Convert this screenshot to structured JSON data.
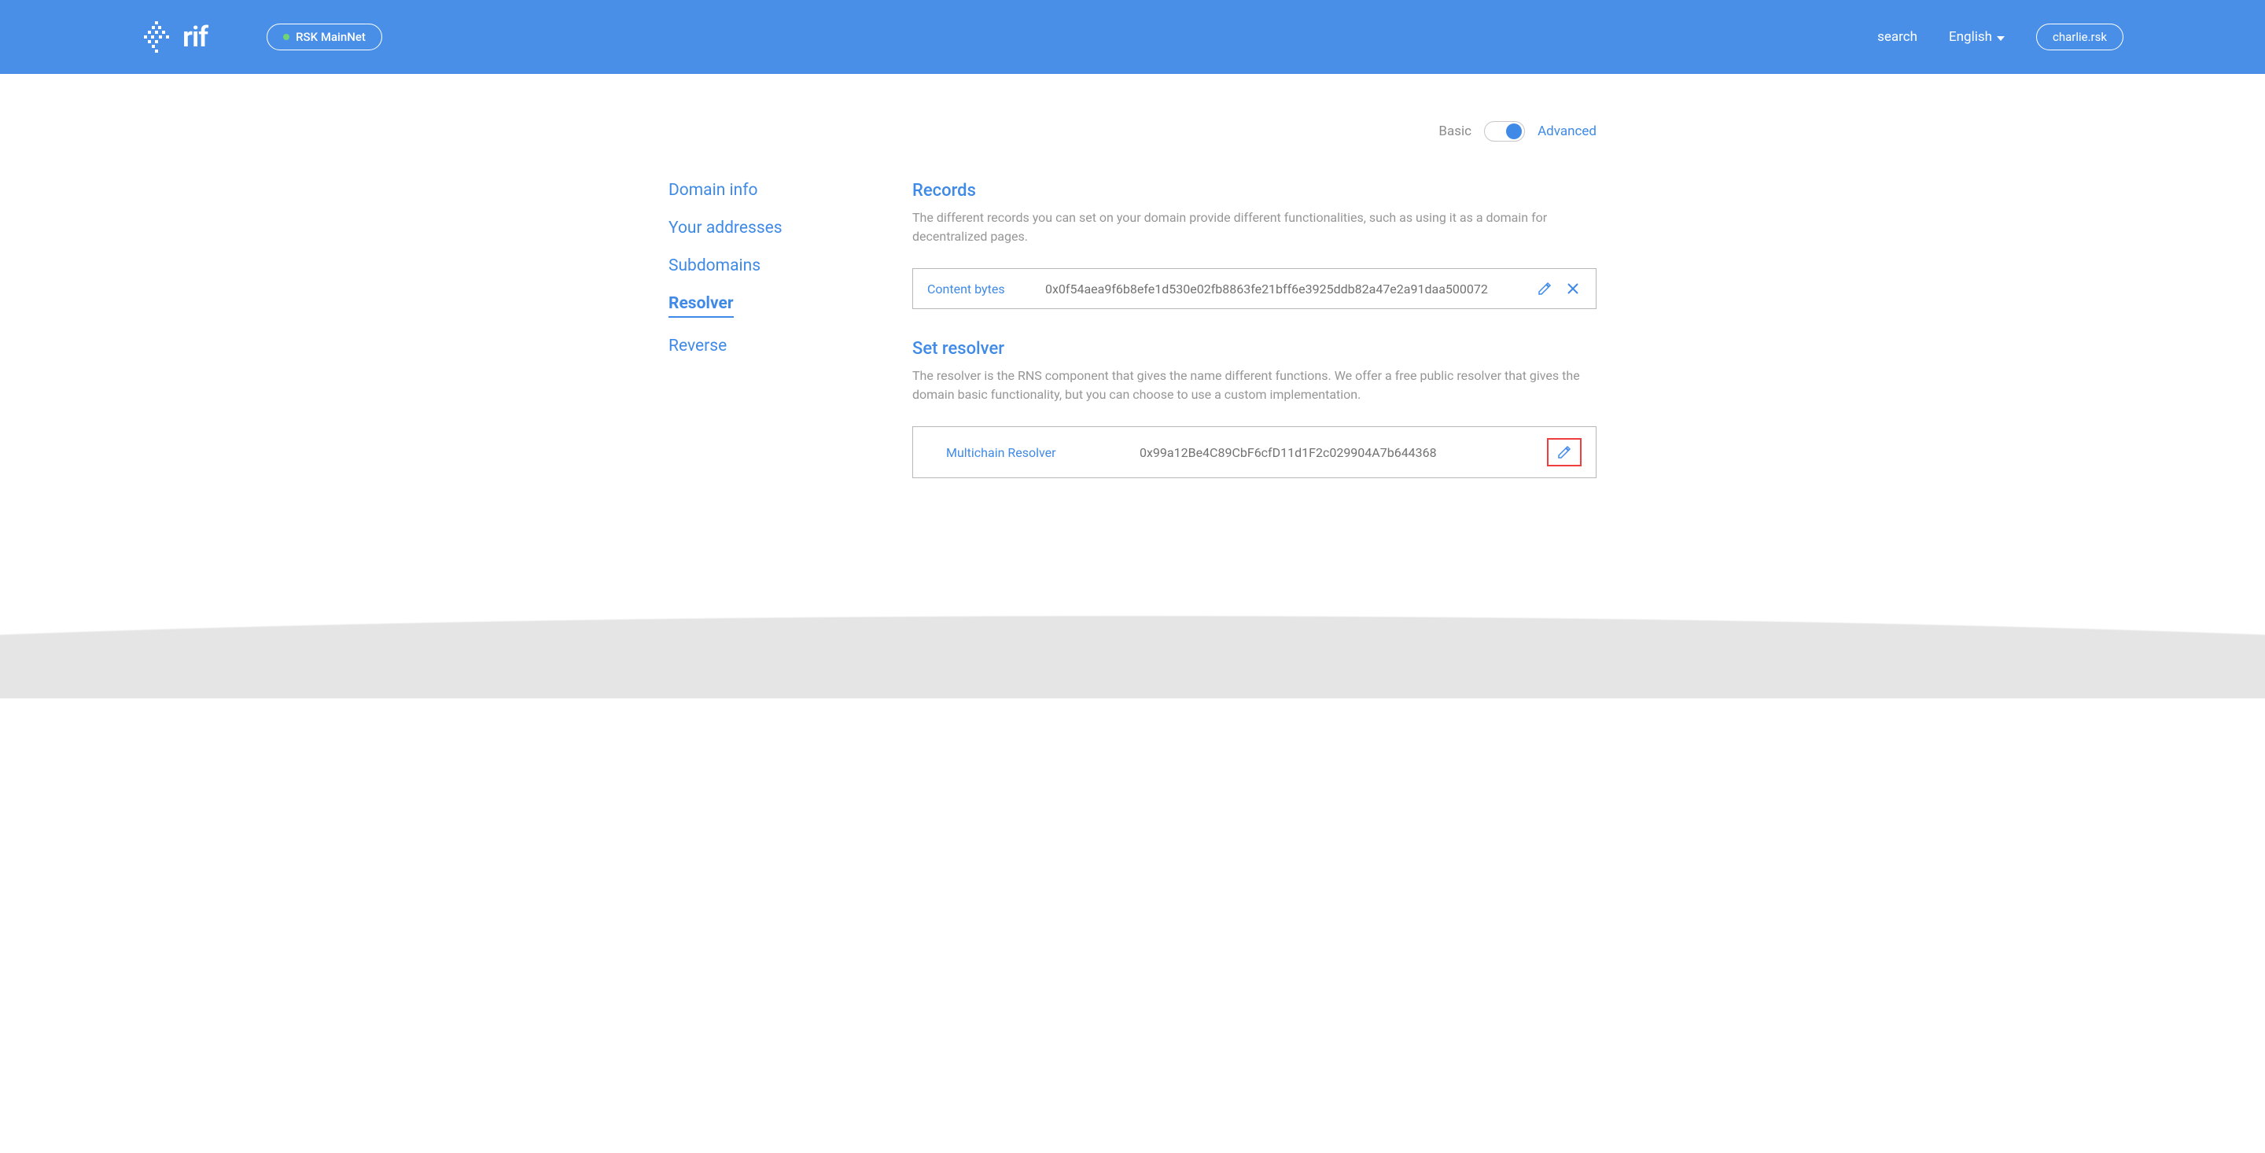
{
  "header": {
    "logo_text": "rif",
    "network": "RSK MainNet",
    "search": "search",
    "language": "English",
    "domain": "charlie.rsk"
  },
  "mode": {
    "basic": "Basic",
    "advanced": "Advanced",
    "current": "advanced"
  },
  "sidebar": {
    "items": [
      {
        "label": "Domain info",
        "active": false
      },
      {
        "label": "Your addresses",
        "active": false
      },
      {
        "label": "Subdomains",
        "active": false
      },
      {
        "label": "Resolver",
        "active": true
      },
      {
        "label": "Reverse",
        "active": false
      }
    ]
  },
  "records": {
    "title": "Records",
    "description": "The different records you can set on your domain provide different functionalities, such as using it as a domain for decentralized pages.",
    "items": [
      {
        "label": "Content bytes",
        "value": "0x0f54aea9f6b8efe1d530e02fb8863fe21bff6e3925ddb82a47e2a91daa500072"
      }
    ]
  },
  "resolver": {
    "title": "Set resolver",
    "description": "The resolver is the RNS component that gives the name different functions. We offer a free public resolver that gives the domain basic functionality, but you can choose to use a custom implementation.",
    "label": "Multichain Resolver",
    "value": "0x99a12Be4C89CbF6cfD11d1F2c029904A7b644368"
  }
}
